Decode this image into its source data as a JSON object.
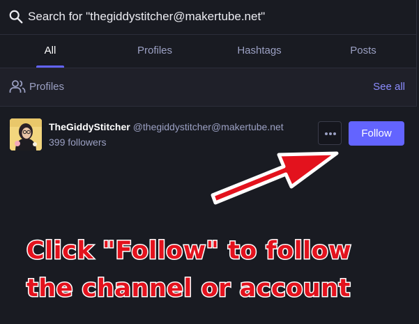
{
  "search": {
    "query": "Search for \"thegiddystitcher@makertube.net\"",
    "icon": "search-icon"
  },
  "tabs": [
    {
      "label": "All",
      "active": true
    },
    {
      "label": "Profiles",
      "active": false
    },
    {
      "label": "Hashtags",
      "active": false
    },
    {
      "label": "Posts",
      "active": false
    }
  ],
  "section": {
    "title": "Profiles",
    "icon": "people-icon",
    "see_all": "See all"
  },
  "account": {
    "display_name": "TheGiddyStitcher",
    "handle": "@thegiddystitcher@makertube.net",
    "followers": "399 followers",
    "more_icon": "ellipsis-icon",
    "follow_label": "Follow"
  },
  "annotation": {
    "line1": "Click \"Follow\" to follow",
    "line2": "the channel or account",
    "color": "#e3121d"
  },
  "colors": {
    "accent": "#6364ff",
    "background": "#191b22",
    "muted": "#9ba0c3"
  }
}
